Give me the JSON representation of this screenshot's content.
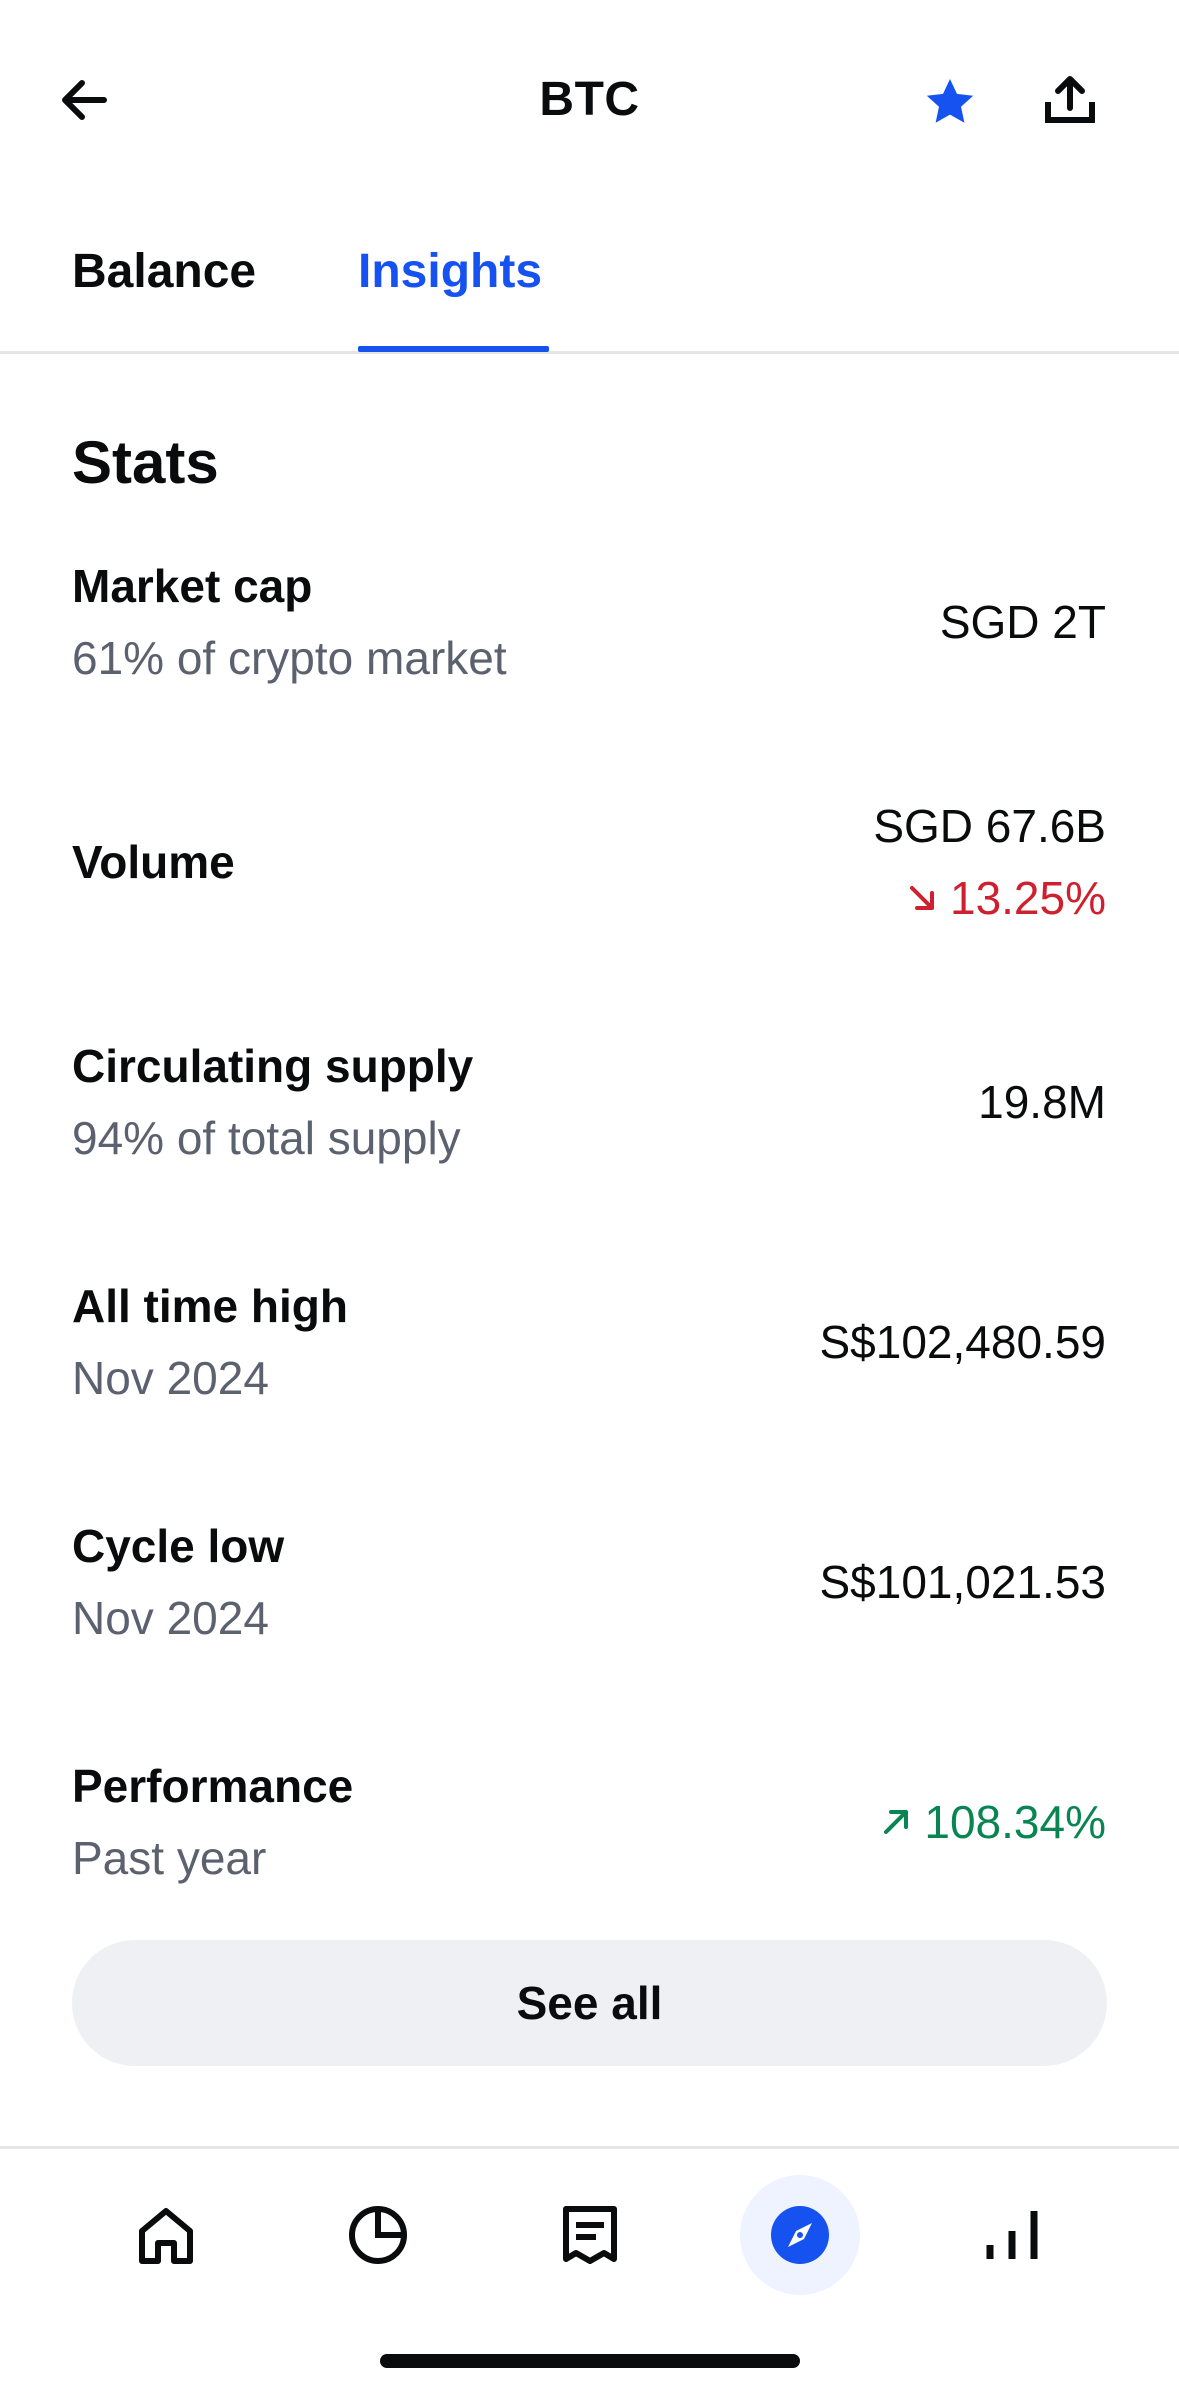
{
  "header": {
    "title": "BTC",
    "icons": {
      "back": "back-arrow-icon",
      "favorite": "star-icon",
      "share": "share-icon"
    },
    "favorite_color": "#1652f0"
  },
  "tabs": [
    {
      "label": "Balance",
      "active": false
    },
    {
      "label": "Insights",
      "active": true
    }
  ],
  "stats": {
    "title": "Stats",
    "rows": [
      {
        "label": "Market cap",
        "sub": "61% of crypto market",
        "value": "SGD 2T"
      },
      {
        "label": "Volume",
        "value": "SGD 67.6B",
        "change": "13.25%",
        "change_direction": "down"
      },
      {
        "label": "Circulating supply",
        "sub": "94% of total supply",
        "value": "19.8M"
      },
      {
        "label": "All time high",
        "sub": "Nov 2024",
        "value": "S$102,480.59"
      },
      {
        "label": "Cycle low",
        "sub": "Nov 2024",
        "value": "S$101,021.53"
      },
      {
        "label": "Performance",
        "sub": "Past year",
        "change": "108.34%",
        "change_direction": "up"
      }
    ]
  },
  "see_all_label": "See all",
  "bottom_nav": [
    {
      "icon": "home-icon",
      "active": false
    },
    {
      "icon": "portfolio-pie-icon",
      "active": false
    },
    {
      "icon": "transactions-receipt-icon",
      "active": false
    },
    {
      "icon": "explore-compass-icon",
      "active": true
    },
    {
      "icon": "markets-chart-icon",
      "active": false
    }
  ],
  "colors": {
    "accent": "#1652f0",
    "negative": "#cf202f",
    "positive": "#098551",
    "muted": "#5b616e"
  }
}
